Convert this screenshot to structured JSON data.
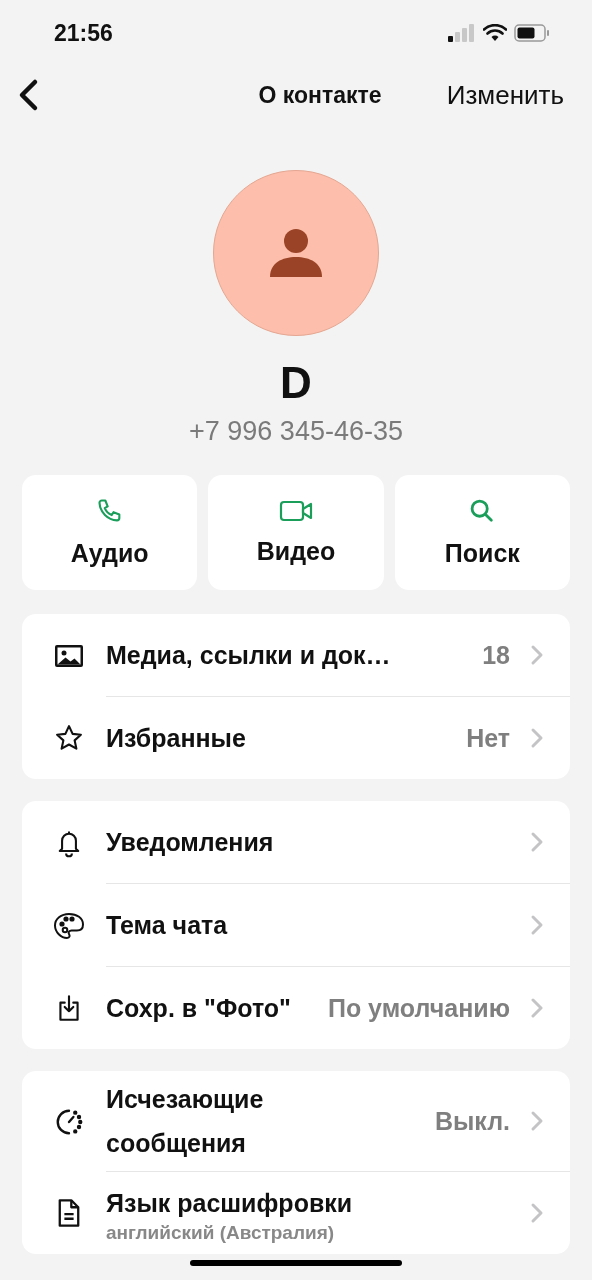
{
  "status_bar": {
    "time": "21:56"
  },
  "nav": {
    "title": "О контакте",
    "action": "Изменить"
  },
  "contact": {
    "name": "D",
    "phone": "+7 996 345-46-35"
  },
  "actions": [
    {
      "label": "Аудио"
    },
    {
      "label": "Видео"
    },
    {
      "label": "Поиск"
    }
  ],
  "groups": [
    {
      "rows": [
        {
          "label": "Медиа, ссылки и док…",
          "value": "18"
        },
        {
          "label": "Избранные",
          "value": "Нет"
        }
      ]
    },
    {
      "rows": [
        {
          "label": "Уведомления"
        },
        {
          "label": "Тема чата"
        },
        {
          "label": "Сохр. в \"Фото\"",
          "value": "По умолчанию"
        }
      ]
    },
    {
      "rows": [
        {
          "label": "Исчезающие сообщения",
          "value": "Выкл."
        },
        {
          "label": "Язык расшифровки",
          "subtitle": "английский (Австралия)"
        }
      ]
    }
  ]
}
